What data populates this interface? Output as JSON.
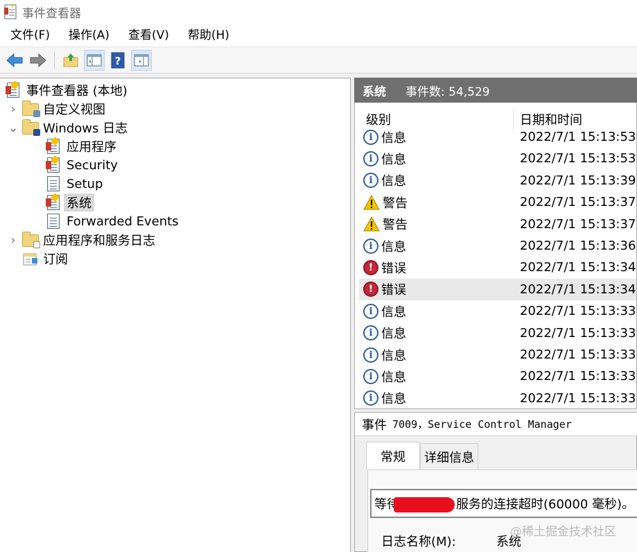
{
  "window": {
    "title": "事件查看器"
  },
  "menu": [
    "文件(F)",
    "操作(A)",
    "查看(V)",
    "帮助(H)"
  ],
  "toolbar": {
    "buttons": [
      "back-arrow-icon",
      "forward-arrow-icon",
      "up-folder-icon",
      "show-hide-tree-icon",
      "help-icon",
      "show-hide-action-pane-icon"
    ]
  },
  "tree": {
    "root": "事件查看器 (本地)",
    "custom_views": "自定义视图",
    "windows_logs": "Windows 日志",
    "windows_children": [
      "应用程序",
      "Security",
      "Setup",
      "系统",
      "Forwarded Events"
    ],
    "selected": "系统",
    "app_service_logs": "应用程序和服务日志",
    "subscriptions": "订阅"
  },
  "header": {
    "title": "系统",
    "count": "事件数: 54,529"
  },
  "list": {
    "columns": [
      "级别",
      "日期和时间"
    ],
    "rows": [
      {
        "level": "信息",
        "kind": "info",
        "time": "2022/7/1 15:13:53"
      },
      {
        "level": "信息",
        "kind": "info",
        "time": "2022/7/1 15:13:53"
      },
      {
        "level": "信息",
        "kind": "info",
        "time": "2022/7/1 15:13:39"
      },
      {
        "level": "警告",
        "kind": "warn",
        "time": "2022/7/1 15:13:37"
      },
      {
        "level": "警告",
        "kind": "warn",
        "time": "2022/7/1 15:13:37"
      },
      {
        "level": "信息",
        "kind": "info",
        "time": "2022/7/1 15:13:36"
      },
      {
        "level": "错误",
        "kind": "error",
        "time": "2022/7/1 15:13:34"
      },
      {
        "level": "错误",
        "kind": "error",
        "time": "2022/7/1 15:13:34",
        "selected": true
      },
      {
        "level": "信息",
        "kind": "info",
        "time": "2022/7/1 15:13:33"
      },
      {
        "level": "信息",
        "kind": "info",
        "time": "2022/7/1 15:13:33"
      },
      {
        "level": "信息",
        "kind": "info",
        "time": "2022/7/1 15:13:33"
      },
      {
        "level": "信息",
        "kind": "info",
        "time": "2022/7/1 15:13:33"
      },
      {
        "level": "信息",
        "kind": "info",
        "time": "2022/7/1 15:13:33"
      }
    ]
  },
  "detail": {
    "label": "事件",
    "event": "7009，Service Control Manager",
    "tabs": [
      "常规",
      "详细信息"
    ],
    "message_prefix": "等待",
    "message_suffix": "服务的连接超时(60000 毫秒)。",
    "log_name_label": "日志名称(M):",
    "log_name_value": "系统"
  },
  "watermark": "@稀土掘金技术社区",
  "colors": {
    "header_bg": "#6f6f6f",
    "selected_row": "#e9e9e9",
    "error": "#c4283a",
    "info": "#2f5f9f",
    "warning": "#f4c400"
  }
}
